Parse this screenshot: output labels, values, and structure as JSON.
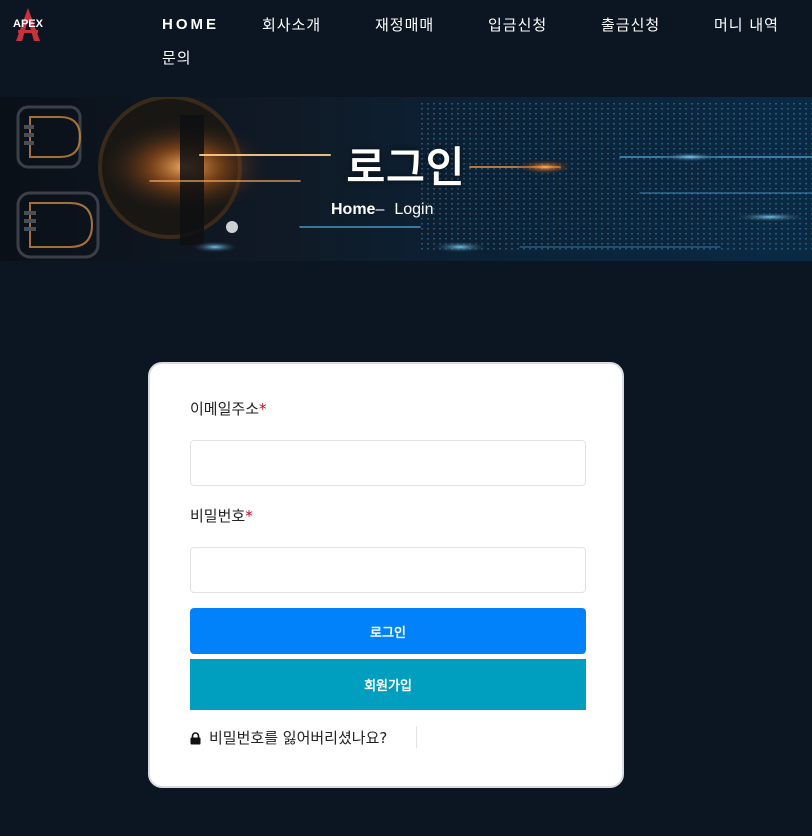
{
  "brand": {
    "logo_text": "APEX"
  },
  "nav": {
    "items": [
      {
        "label": "HOME"
      },
      {
        "label": "회사소개"
      },
      {
        "label": "재정매매"
      },
      {
        "label": "입금신청"
      },
      {
        "label": "출금신청"
      },
      {
        "label": "머니 내역"
      },
      {
        "label": "문의"
      }
    ]
  },
  "banner": {
    "title": "로그인",
    "breadcrumb": {
      "home": "Home",
      "separator": "–",
      "current": "Login"
    }
  },
  "login_form": {
    "email_label": "이메일주소",
    "password_label": "비밀번호",
    "required_mark": "*",
    "email_value": "",
    "password_value": "",
    "login_button": "로그인",
    "signup_button": "회원가입",
    "forgot_password": "비밀번호를 잃어버리셨나요?"
  },
  "colors": {
    "page_bg": "#0c1622",
    "login_button": "#0282fa",
    "signup_button": "#009fbf",
    "required": "#d0021b"
  }
}
